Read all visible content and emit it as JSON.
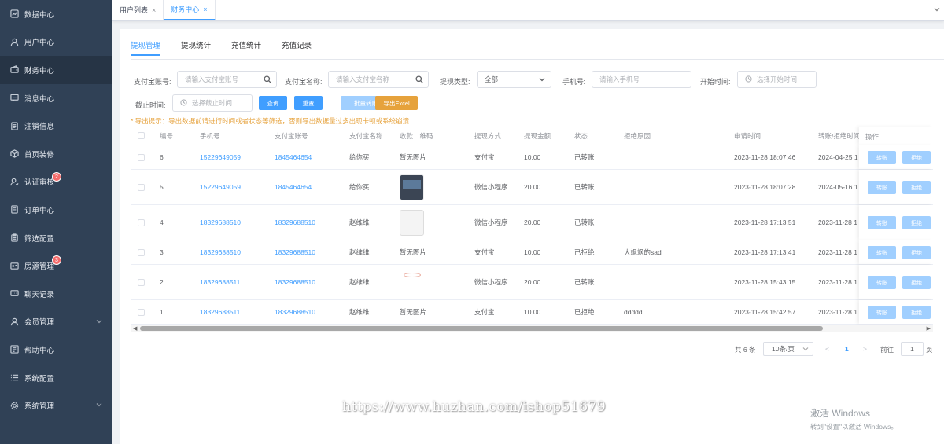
{
  "sidebar": {
    "items": [
      {
        "label": "数据中心",
        "icon": "dashboard-icon"
      },
      {
        "label": "用户中心",
        "icon": "user-icon"
      },
      {
        "label": "财务中心",
        "icon": "wallet-icon",
        "active": true
      },
      {
        "label": "消息中心",
        "icon": "message-icon"
      },
      {
        "label": "注销信息",
        "icon": "document-icon"
      },
      {
        "label": "首页装修",
        "icon": "box-icon"
      },
      {
        "label": "认证审核",
        "icon": "user-check-icon",
        "badge": "2"
      },
      {
        "label": "订单中心",
        "icon": "order-icon"
      },
      {
        "label": "筛选配置",
        "icon": "clipboard-icon"
      },
      {
        "label": "房源管理",
        "icon": "house-icon",
        "badge": "3"
      },
      {
        "label": "聊天记录",
        "icon": "chat-icon"
      },
      {
        "label": "会员管理",
        "icon": "member-icon",
        "chevron": true
      },
      {
        "label": "帮助中心",
        "icon": "help-icon"
      },
      {
        "label": "系统配置",
        "icon": "list-icon"
      },
      {
        "label": "系统管理",
        "icon": "gear-icon",
        "chevron": true
      }
    ]
  },
  "tabbar": {
    "tabs": [
      {
        "label": "用户列表",
        "close": "×"
      },
      {
        "label": "财务中心",
        "close": "×"
      }
    ]
  },
  "subtabs": [
    "提现管理",
    "提现统计",
    "充值统计",
    "充值记录"
  ],
  "filters": {
    "alipay_account_label": "支付宝账号:",
    "alipay_account_placeholder": "请输入支付宝账号",
    "alipay_name_label": "支付宝名称:",
    "alipay_name_placeholder": "请输入支付宝名称",
    "withdraw_type_label": "提现类型:",
    "withdraw_type_value": "全部",
    "phone_label": "手机号:",
    "phone_placeholder": "请输入手机号",
    "start_time_label": "开始时间:",
    "start_time_placeholder": "选择开始时间",
    "end_time_label": "截止时间:",
    "end_time_placeholder": "选择截止时间"
  },
  "buttons": {
    "query": "查询",
    "reset": "重置",
    "batch_transfer": "批量转账",
    "export_excel": "导出Excel"
  },
  "tip": "* 导出提示：导出数据前请进行时间或者状态等筛选，否则导出数据量过多出现卡顿或系统崩溃",
  "table": {
    "headers": {
      "id": "编号",
      "phone": "手机号",
      "alipay_account": "支付宝账号",
      "alipay_name": "支付宝名称",
      "qr": "收款二维码",
      "method": "提现方式",
      "amount": "提现金额",
      "status": "状态",
      "reason": "拒绝原因",
      "apply_time": "申请时间",
      "transfer_time": "转账/拒绝时间",
      "ops": "操作"
    },
    "op_transfer": "转账",
    "op_reject": "拒绝",
    "rows": [
      {
        "id": "6",
        "phone": "15229649059",
        "alipay_account": "1845464654",
        "alipay_name": "给你买",
        "qr": "暂无图片",
        "method": "支付宝",
        "amount": "10.00",
        "status": "已转账",
        "reason": "",
        "apply_time": "2023-11-28 18:07:46",
        "transfer_time": "2024-04-25 1"
      },
      {
        "id": "5",
        "phone": "15229649059",
        "alipay_account": "1845464654",
        "alipay_name": "给你买",
        "qr": "",
        "method": "微信小程序",
        "amount": "20.00",
        "status": "已转账",
        "reason": "",
        "apply_time": "2023-11-28 18:07:28",
        "transfer_time": "2024-05-16 1"
      },
      {
        "id": "4",
        "phone": "18329688510",
        "alipay_account": "18329688510",
        "alipay_name": "赵维维",
        "qr": "",
        "method": "微信小程序",
        "amount": "20.00",
        "status": "已转账",
        "reason": "",
        "apply_time": "2023-11-28 17:13:51",
        "transfer_time": "2023-11-28 1"
      },
      {
        "id": "3",
        "phone": "18329688510",
        "alipay_account": "18329688510",
        "alipay_name": "赵维维",
        "qr": "暂无图片",
        "method": "支付宝",
        "amount": "10.00",
        "status": "已拒绝",
        "reason": "大飒飒的sad",
        "apply_time": "2023-11-28 17:13:41",
        "transfer_time": "2023-11-28 1"
      },
      {
        "id": "2",
        "phone": "18329688511",
        "alipay_account": "18329688510",
        "alipay_name": "赵维维",
        "qr": "",
        "method": "微信小程序",
        "amount": "20.00",
        "status": "已转账",
        "reason": "",
        "apply_time": "2023-11-28 15:43:15",
        "transfer_time": "2023-11-28 1"
      },
      {
        "id": "1",
        "phone": "18329688511",
        "alipay_account": "18329688510",
        "alipay_name": "赵维维",
        "qr": "暂无图片",
        "method": "支付宝",
        "amount": "10.00",
        "status": "已拒绝",
        "reason": "ddddd",
        "apply_time": "2023-11-28 15:42:57",
        "transfer_time": "2023-11-28 1"
      }
    ]
  },
  "pagination": {
    "total": "共 6 条",
    "page_size": "10条/页",
    "prev": "<",
    "current": "1",
    "next": ">",
    "goto_label": "前往",
    "goto_value": "1",
    "goto_suffix": "页"
  },
  "watermark": "https://www.huzhan.com/ishop51679",
  "windows_activation": {
    "title": "激活 Windows",
    "subtitle": "转到\"设置\"以激活 Windows。"
  },
  "colors": {
    "accent": "#409eff",
    "sidebar_bg": "#304156",
    "warning": "#e6a23c"
  }
}
